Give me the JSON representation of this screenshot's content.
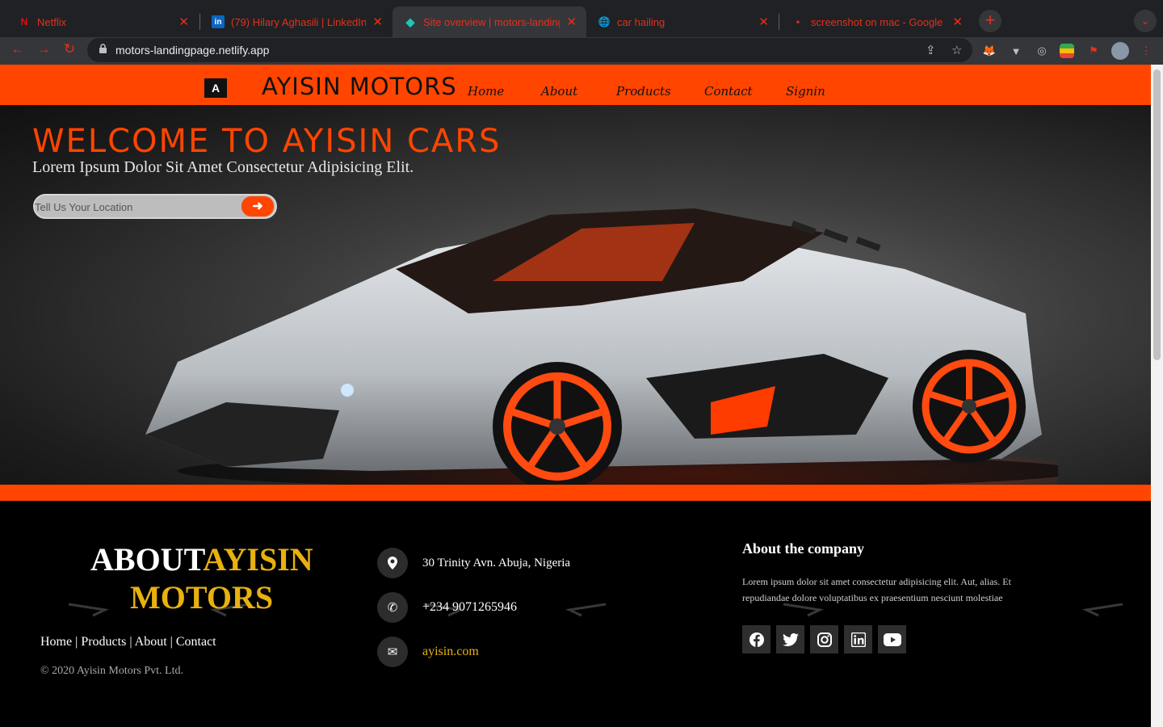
{
  "browser": {
    "tabs": [
      {
        "title": "Netflix",
        "favicon": "N"
      },
      {
        "title": "(79) Hilary Aghasili | LinkedIn",
        "favicon": "in"
      },
      {
        "title": "Site overview | motors-landing",
        "favicon": "◆"
      },
      {
        "title": "car hailing",
        "favicon": "🌐"
      },
      {
        "title": "screenshot on mac - Google S",
        "favicon": "•"
      }
    ],
    "active_tab_index": 2,
    "url": "motors-landingpage.netlify.app",
    "icons": [
      "back-icon",
      "forward-icon",
      "reload-icon",
      "lock-icon",
      "share-icon",
      "star-icon",
      "new-tab-icon",
      "tab-search-icon"
    ],
    "accent_color": "#e0321c"
  },
  "site": {
    "logo_letter": "A",
    "brand": "AYISIN MOTORS",
    "nav": [
      "Home",
      "About",
      "Products",
      "Contact",
      "Signin"
    ],
    "brand_color": "#ff4500"
  },
  "hero": {
    "title": "WELCOME TO AYISIN CARS",
    "subtitle": "Lorem Ipsum Dolor Sit Amet Consectetur Adipisicing Elit.",
    "location_placeholder": "Tell Us Your Location",
    "submit_icon": "arrow-right-icon"
  },
  "footer": {
    "about_title_white": "ABOUT",
    "about_title_yellow1": "AYISIN",
    "about_title_yellow2": "MOTORS",
    "links": [
      "Home",
      "Products",
      "About",
      "Contact"
    ],
    "link_separator": " | ",
    "copyright": "© 2020 Ayisin Motors Pvt. Ltd.",
    "contacts": [
      {
        "icon": "map-marker-icon",
        "text": "30 Trinity Avn. Abuja, Nigeria"
      },
      {
        "icon": "phone-icon",
        "text": "+234 9071265946"
      },
      {
        "icon": "envelope-icon",
        "text": "ayisin.com"
      }
    ],
    "about_company_heading": "About the company",
    "about_company_text": "Lorem ipsum dolor sit amet consectetur adipisicing elit. Aut, alias. Et repudiandae dolore voluptatibus ex praesentium nesciunt molestiae",
    "social": [
      "facebook-icon",
      "twitter-icon",
      "instagram-icon",
      "linkedin-icon",
      "youtube-icon"
    ],
    "highlight_color": "#e8b10f"
  }
}
